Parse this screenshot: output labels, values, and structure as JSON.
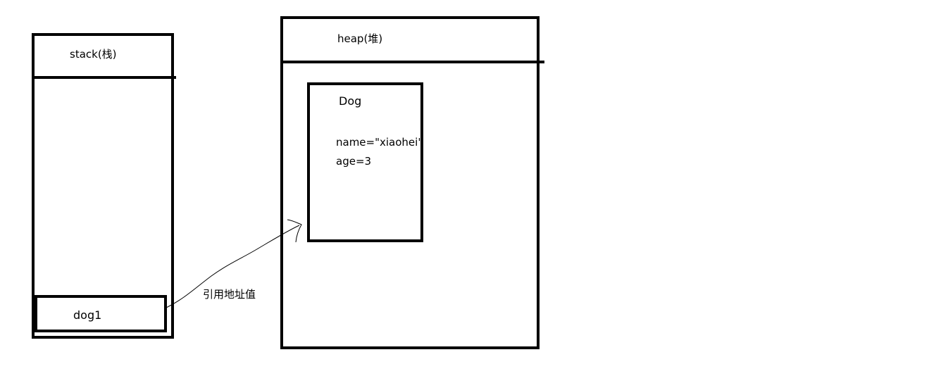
{
  "stack": {
    "title": "stack(栈)",
    "variable": "dog1"
  },
  "heap": {
    "title": "heap(堆)",
    "object": {
      "class_name": "Dog",
      "fields": [
        "name=\"xiaohei\"",
        "age=3"
      ]
    }
  },
  "reference": {
    "label": "引用地址值"
  }
}
